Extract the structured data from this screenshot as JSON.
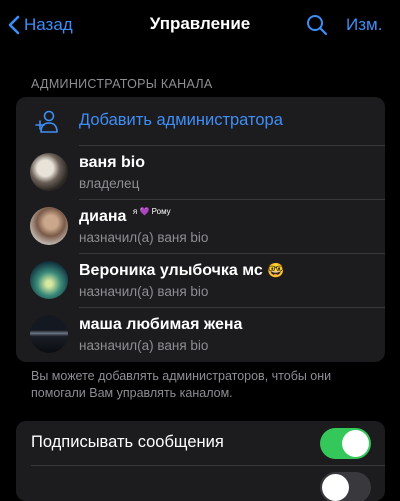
{
  "nav": {
    "back_label": "Назад",
    "title": "Управление",
    "edit_label": "Изм."
  },
  "admins_section": {
    "header": "АДМИНИСТРАТОРЫ КАНАЛА",
    "add_label": "Добавить администратора",
    "admins": [
      {
        "name": "ваня bio",
        "subtitle": "владелец",
        "badge": ""
      },
      {
        "name": "диана",
        "subtitle": "назначил(а) ваня bio",
        "badge": "я 💜 Рому"
      },
      {
        "name": "Вероника улыбочка мс",
        "subtitle": "назначил(а) ваня bio",
        "badge": "🤓"
      },
      {
        "name": "маша любимая жена",
        "subtitle": "назначил(а) ваня bio",
        "badge": ""
      }
    ],
    "footer": "Вы можете добавлять администраторов, чтобы они помогали Вам управлять каналом."
  },
  "settings": {
    "sign_messages_label": "Подписывать сообщения",
    "sign_messages_on": true,
    "second_toggle_on": false
  },
  "colors": {
    "accent": "#3e8ef7",
    "toggle_on": "#34c759",
    "toggle_off": "#39393d"
  }
}
